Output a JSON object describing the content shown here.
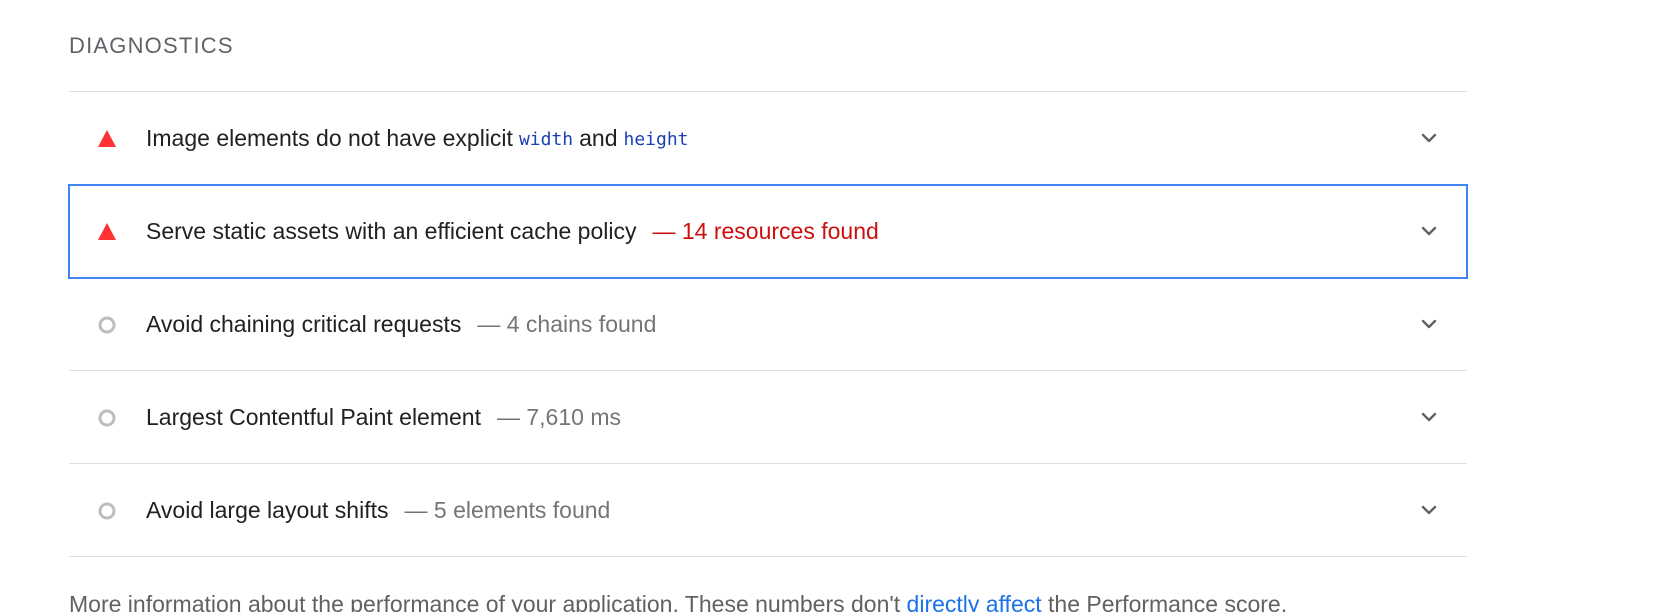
{
  "section": {
    "title": "DIAGNOSTICS"
  },
  "colors": {
    "fail": "#ff3333",
    "informative": "#bdbdbd",
    "focus_outline": "#4285f4",
    "fail_text": "#cc0f0f",
    "link": "#1a73e8"
  },
  "audits": [
    {
      "status": "fail",
      "icon": "warning-triangle-icon",
      "title_before": "Image elements do not have explicit",
      "code1": "width",
      "title_mid": "and",
      "code2": "height",
      "display_value": ""
    },
    {
      "status": "fail",
      "icon": "warning-triangle-icon",
      "title": "Serve static assets with an efficient cache policy",
      "display_value": "— 14 resources found",
      "focused": true
    },
    {
      "status": "informative",
      "icon": "circle-icon",
      "title": "Avoid chaining critical requests",
      "display_value": "— 4 chains found"
    },
    {
      "status": "informative",
      "icon": "circle-icon",
      "title": "Largest Contentful Paint element",
      "display_value": "— 7,610 ms"
    },
    {
      "status": "informative",
      "icon": "circle-icon",
      "title": "Avoid large layout shifts",
      "display_value": "— 5 elements found"
    }
  ],
  "footer": {
    "text_before": "More information about the performance of your application. These numbers don't ",
    "link_text": "directly affect",
    "text_after": " the Performance score."
  }
}
